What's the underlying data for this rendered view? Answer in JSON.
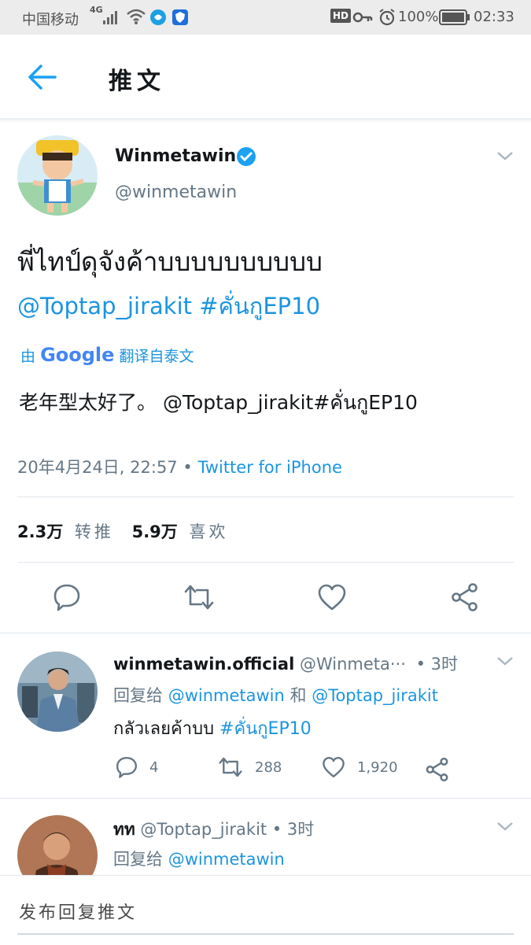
{
  "status_bar": {
    "carrier": "中国移动",
    "network": "4G",
    "hd": "HD",
    "battery": "100%",
    "time": "02:33"
  },
  "header": {
    "title": "推文",
    "back_icon": "arrow-left-icon"
  },
  "tweet": {
    "display_name": "Winmetawin",
    "handle": "@winmetawin",
    "verified": true,
    "text_line1": "พี่ไทป์ดุจังค้าบบบบบบบบบบ",
    "mention": "@Toptap_jirakit",
    "hashtag": "#คั่นกูEP10",
    "translated_by_prefix": "由",
    "translated_by_brand": "Google",
    "translated_by_suffix": "翻译自泰文",
    "translation_text": "老年型太好了。",
    "translation_tail": "@Toptap_jirakit#คั่นกูEP10",
    "timestamp": "20年4月24日, 22:57",
    "separator": "•",
    "source": "Twitter for iPhone",
    "retweets_count": "2.3万",
    "retweets_label": "转推",
    "likes_count": "5.9万",
    "likes_label": "喜欢"
  },
  "replies": [
    {
      "display_name": "winmetawin.official",
      "handle": "@Winmeta···",
      "time": "• 3时",
      "reply_prefix": "回复给",
      "reply_to1": "@winmetawin",
      "reply_and": "和",
      "reply_to2": "@Toptap_jirakit",
      "text": "กลัวเลยค้าบบ",
      "hashtag": "#คั่นกูEP10",
      "reply_count": "4",
      "retweet_count": "288",
      "like_count": "1,920"
    },
    {
      "display_name": "ทท",
      "handle": "@Toptap_jirakit",
      "time": "• 3时",
      "reply_prefix": "回复给",
      "reply_to1": "@winmetawin"
    }
  ],
  "compose": {
    "placeholder": "发布回复推文"
  },
  "colors": {
    "accent": "#1b95e0",
    "secondary_text": "#657786",
    "divider": "#e1e8ed"
  }
}
